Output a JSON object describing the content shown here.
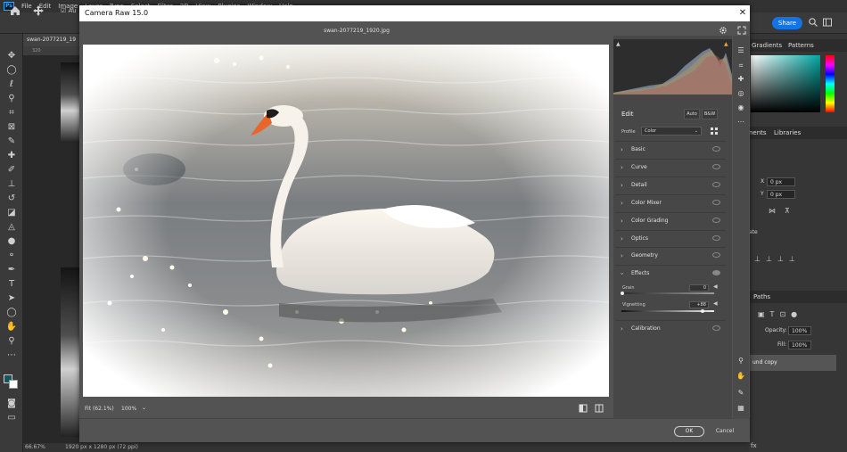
{
  "photoshop": {
    "logo": "Ps",
    "menu": [
      "File",
      "Edit",
      "Image",
      "Layer",
      "Type",
      "Select",
      "Filter",
      "3D",
      "View",
      "Plugins",
      "Window",
      "Help"
    ],
    "autoselect_label": "Au",
    "share_label": "Share",
    "doc_tab": "swan-2077219_19",
    "ruler_label": "320",
    "status_zoom": "66.67%",
    "status_info": "1920 px x 1280 px (72 ppi)",
    "panel_tabs_top": [
      "Gradients",
      "Patterns"
    ],
    "panel_tabs_mid": [
      "nents",
      "Libraries"
    ],
    "x_label": "X",
    "x_value": "0 px",
    "y_label": "Y",
    "y_value": "0 px",
    "mid_label": "ate",
    "paths_tab": "Paths",
    "opacity_label": "Opacity:",
    "opacity_value": "100%",
    "fill_label": "Fill:",
    "fill_value": "100%",
    "layer_name": "und copy",
    "fx_label": "fx"
  },
  "camera_raw": {
    "title": "Camera Raw 15.0",
    "filename": "swan-2077219_1920.jpg",
    "zoom_fit": "Fit (62.1%)",
    "zoom_100": "100%",
    "edit_title": "Edit",
    "auto_label": "Auto",
    "bw_label": "B&W",
    "profile_label": "Profile",
    "profile_value": "Color",
    "sections": [
      "Basic",
      "Curve",
      "Detail",
      "Color Mixer",
      "Color Grading",
      "Optics",
      "Geometry",
      "Effects",
      "Calibration"
    ],
    "grain_label": "Grain",
    "grain_value": "0",
    "vignetting_label": "Vignetting",
    "vignetting_value": "+88",
    "ok_label": "OK",
    "cancel_label": "Cancel"
  }
}
